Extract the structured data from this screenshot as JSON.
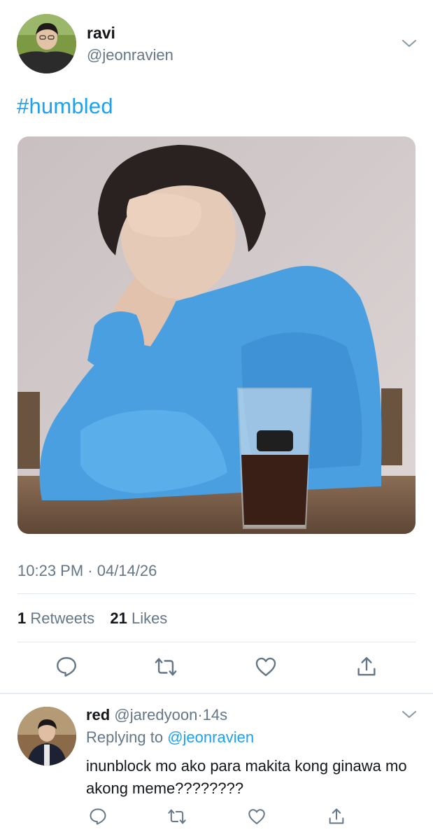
{
  "tweet": {
    "name": "ravi",
    "handle": "@jeonravien",
    "text": "#humbled",
    "timestamp": "10:23 PM · 04/14/26",
    "retweets_count": "1",
    "retweets_label": "Retweets",
    "likes_count": "21",
    "likes_label": "Likes"
  },
  "reply": {
    "name": "red",
    "handle": "@jaredyoon",
    "separator": "·",
    "time": "14s",
    "replying_prefix": "Replying to",
    "replying_to": "@jeonravien",
    "text": "inunblock mo ako para makita kong ginawa mo akong meme????????"
  },
  "icons": [
    "chevron-down-icon",
    "reply-icon",
    "retweet-icon",
    "like-icon",
    "share-icon"
  ],
  "colors": {
    "accent": "#1da1f2",
    "secondary_text": "#657786",
    "divider": "#e1e8ed",
    "sweater": "#4a9fe0"
  }
}
